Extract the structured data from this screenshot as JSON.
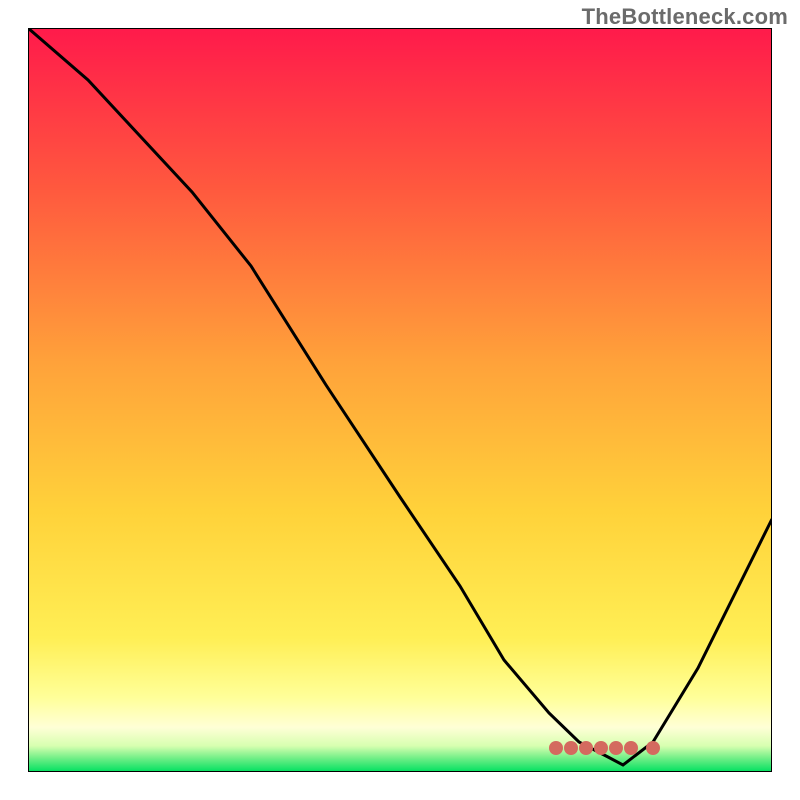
{
  "watermark": "TheBottleneck.com",
  "colors": {
    "gradient_top": "#ff1a4b",
    "gradient_mid_upper": "#ff7a3a",
    "gradient_mid": "#ffd23a",
    "gradient_lower": "#ffff66",
    "gradient_cream": "#ffffcc",
    "gradient_bottom": "#00e060",
    "curve": "#000000",
    "marker": "#d46a5f",
    "frame": "#000000"
  },
  "chart_data": {
    "type": "line",
    "title": "",
    "xlabel": "",
    "ylabel": "",
    "xlim": [
      0,
      100
    ],
    "ylim": [
      0,
      100
    ],
    "x": [
      0,
      8,
      22,
      30,
      40,
      50,
      58,
      64,
      70,
      74,
      78,
      80,
      84,
      90,
      100
    ],
    "values": [
      100,
      93,
      78,
      68,
      52,
      37,
      25,
      15,
      8,
      4,
      2,
      1,
      4,
      14,
      34
    ],
    "optimum_x": 80,
    "optimum_y": 1,
    "marker_cluster_x": [
      71,
      73,
      75,
      77,
      79,
      81,
      84
    ],
    "marker_cluster_y": [
      3.2,
      3.2,
      3.2,
      3.2,
      3.2,
      3.2,
      3.2
    ],
    "annotations": []
  }
}
